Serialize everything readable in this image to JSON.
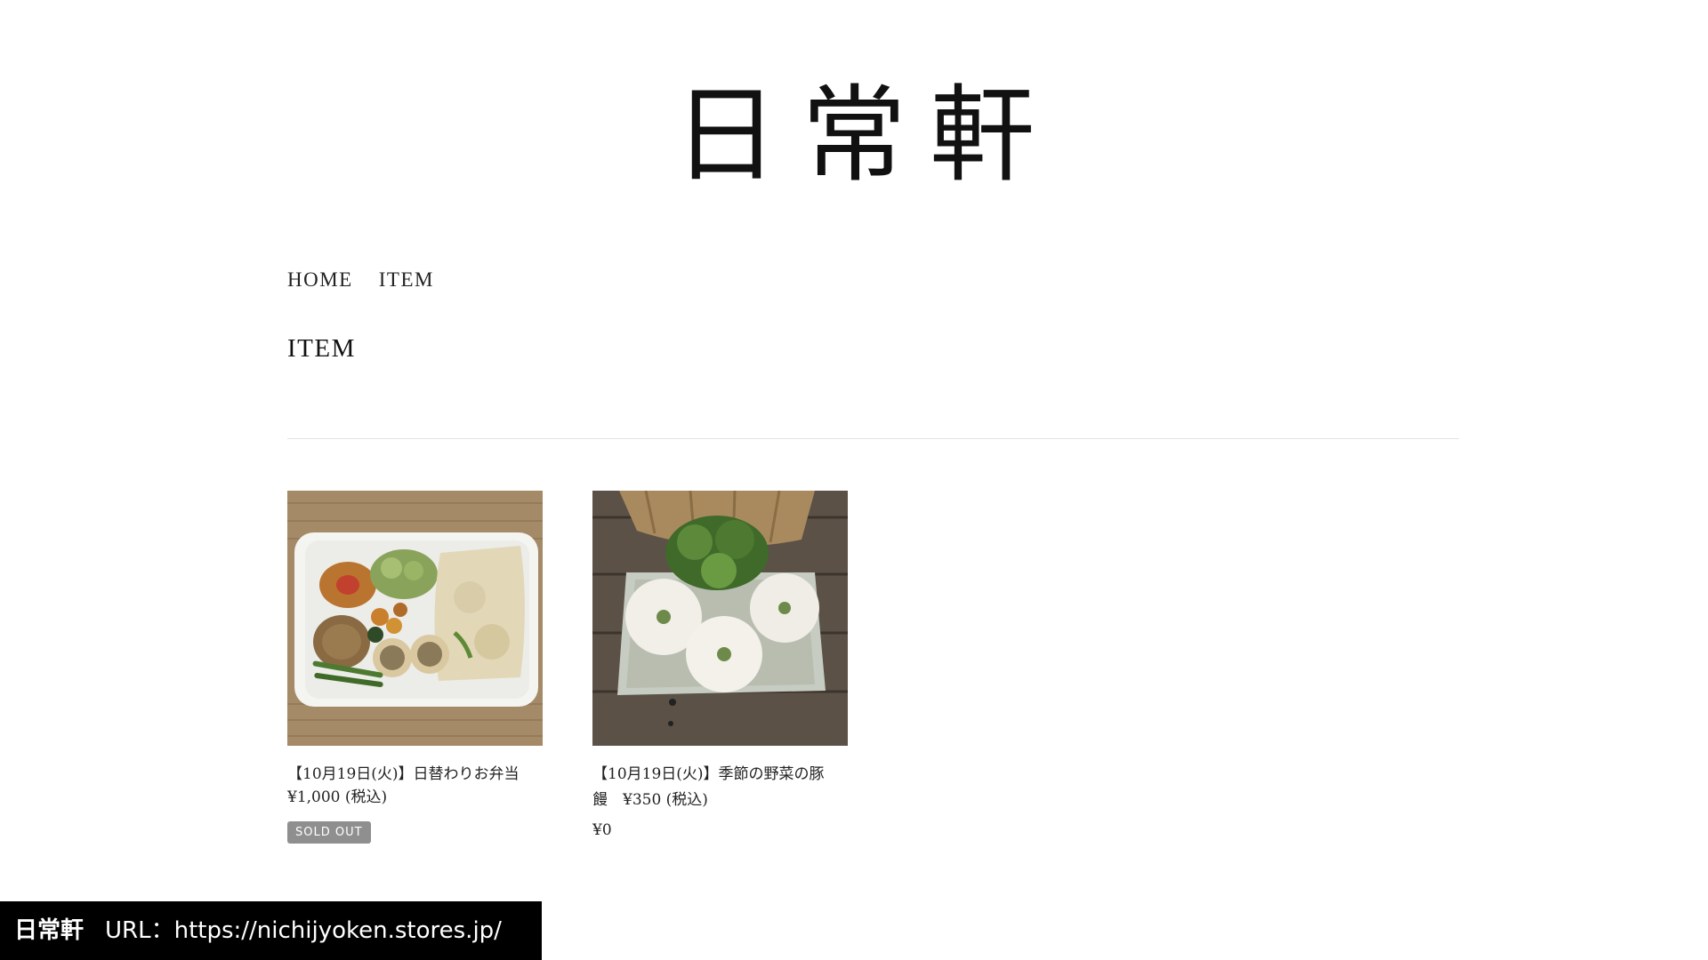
{
  "site": {
    "logo_text": "日常軒"
  },
  "breadcrumb": {
    "items": [
      {
        "label": "HOME"
      },
      {
        "label": "ITEM"
      }
    ]
  },
  "page_title": "ITEM",
  "products": [
    {
      "name": "【10月19日(火)】日替わりお弁当",
      "price_line": "¥1,000 (税込)",
      "badge": "SOLD OUT",
      "image": "bento-box-photo"
    },
    {
      "name": "【10月19日(火)】季節の野菜の豚",
      "name_line2": "饅",
      "name_price": "¥350 (税込)",
      "price": "¥0",
      "image": "steamed-buns-photo"
    }
  ],
  "caption": {
    "brand": "日常軒",
    "url_text": "URL：https://nichijyoken.stores.jp/"
  },
  "colors": {
    "badge_bg": "#8f8f8f",
    "caption_bg": "#000000",
    "divider": "#e2e2e2"
  }
}
